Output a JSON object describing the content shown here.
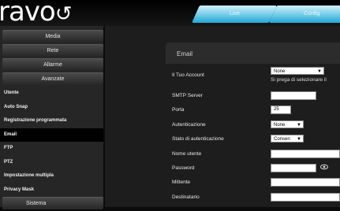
{
  "brand": {
    "name": "ravo"
  },
  "nav_tabs": [
    {
      "label": "Live"
    },
    {
      "label": "Config"
    }
  ],
  "sidebar": {
    "items": [
      {
        "label": "Media",
        "kind": "top"
      },
      {
        "label": "Rete",
        "kind": "top"
      },
      {
        "label": "Allarme",
        "kind": "top"
      },
      {
        "label": "Avanzate",
        "kind": "top"
      },
      {
        "label": "Utente",
        "kind": "sub"
      },
      {
        "label": "Auto Snap",
        "kind": "sub"
      },
      {
        "label": "Registrazione programmata",
        "kind": "sub"
      },
      {
        "label": "Email",
        "kind": "sub",
        "selected": true
      },
      {
        "label": "FTP",
        "kind": "sub"
      },
      {
        "label": "PTZ",
        "kind": "sub"
      },
      {
        "label": "Impostazione multipla",
        "kind": "sub"
      },
      {
        "label": "Privacy Mask",
        "kind": "sub"
      },
      {
        "label": "Sistema",
        "kind": "top"
      }
    ]
  },
  "panel": {
    "title": "Email"
  },
  "form": {
    "account_label": "Il Tuo Account",
    "account_value": "None",
    "account_hint": "Si prega di selezionare il",
    "smtp_label": "SMTP Server",
    "smtp_value": "",
    "port_label": "Porta",
    "port_value": "25",
    "auth_label": "Autenticazione",
    "auth_value": "None",
    "auth_state_label": "Stato di autenticazione",
    "auth_state_value": "Consen",
    "username_label": "Nome utente",
    "username_value": "",
    "password_label": "Password",
    "password_value": "",
    "sender_label": "Mittente",
    "sender_value": "",
    "recipient_label": "Destinatario",
    "recipient_value": ""
  },
  "icons": {
    "dropdown": "chevron-down-icon",
    "reveal": "eye-icon"
  }
}
